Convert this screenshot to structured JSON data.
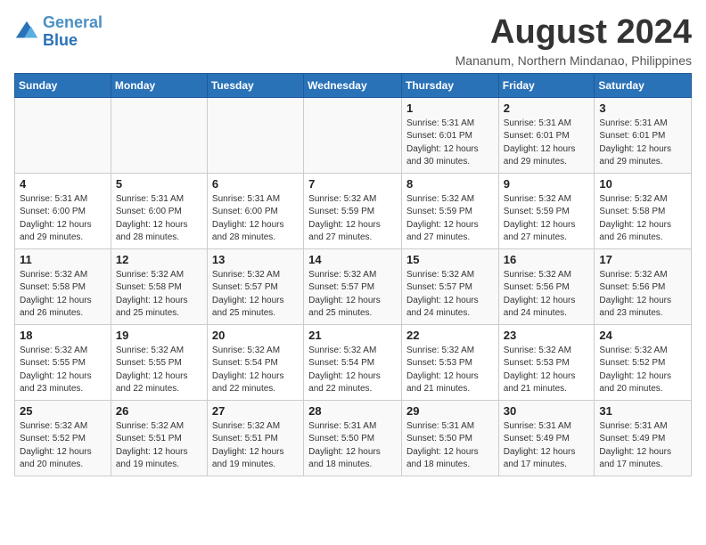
{
  "header": {
    "logo_line1": "General",
    "logo_line2": "Blue",
    "title": "August 2024",
    "subtitle": "Mananum, Northern Mindanao, Philippines"
  },
  "days_of_week": [
    "Sunday",
    "Monday",
    "Tuesday",
    "Wednesday",
    "Thursday",
    "Friday",
    "Saturday"
  ],
  "weeks": [
    [
      {
        "day": "",
        "info": ""
      },
      {
        "day": "",
        "info": ""
      },
      {
        "day": "",
        "info": ""
      },
      {
        "day": "",
        "info": ""
      },
      {
        "day": "1",
        "info": "Sunrise: 5:31 AM\nSunset: 6:01 PM\nDaylight: 12 hours\nand 30 minutes."
      },
      {
        "day": "2",
        "info": "Sunrise: 5:31 AM\nSunset: 6:01 PM\nDaylight: 12 hours\nand 29 minutes."
      },
      {
        "day": "3",
        "info": "Sunrise: 5:31 AM\nSunset: 6:01 PM\nDaylight: 12 hours\nand 29 minutes."
      }
    ],
    [
      {
        "day": "4",
        "info": "Sunrise: 5:31 AM\nSunset: 6:00 PM\nDaylight: 12 hours\nand 29 minutes."
      },
      {
        "day": "5",
        "info": "Sunrise: 5:31 AM\nSunset: 6:00 PM\nDaylight: 12 hours\nand 28 minutes."
      },
      {
        "day": "6",
        "info": "Sunrise: 5:31 AM\nSunset: 6:00 PM\nDaylight: 12 hours\nand 28 minutes."
      },
      {
        "day": "7",
        "info": "Sunrise: 5:32 AM\nSunset: 5:59 PM\nDaylight: 12 hours\nand 27 minutes."
      },
      {
        "day": "8",
        "info": "Sunrise: 5:32 AM\nSunset: 5:59 PM\nDaylight: 12 hours\nand 27 minutes."
      },
      {
        "day": "9",
        "info": "Sunrise: 5:32 AM\nSunset: 5:59 PM\nDaylight: 12 hours\nand 27 minutes."
      },
      {
        "day": "10",
        "info": "Sunrise: 5:32 AM\nSunset: 5:58 PM\nDaylight: 12 hours\nand 26 minutes."
      }
    ],
    [
      {
        "day": "11",
        "info": "Sunrise: 5:32 AM\nSunset: 5:58 PM\nDaylight: 12 hours\nand 26 minutes."
      },
      {
        "day": "12",
        "info": "Sunrise: 5:32 AM\nSunset: 5:58 PM\nDaylight: 12 hours\nand 25 minutes."
      },
      {
        "day": "13",
        "info": "Sunrise: 5:32 AM\nSunset: 5:57 PM\nDaylight: 12 hours\nand 25 minutes."
      },
      {
        "day": "14",
        "info": "Sunrise: 5:32 AM\nSunset: 5:57 PM\nDaylight: 12 hours\nand 25 minutes."
      },
      {
        "day": "15",
        "info": "Sunrise: 5:32 AM\nSunset: 5:57 PM\nDaylight: 12 hours\nand 24 minutes."
      },
      {
        "day": "16",
        "info": "Sunrise: 5:32 AM\nSunset: 5:56 PM\nDaylight: 12 hours\nand 24 minutes."
      },
      {
        "day": "17",
        "info": "Sunrise: 5:32 AM\nSunset: 5:56 PM\nDaylight: 12 hours\nand 23 minutes."
      }
    ],
    [
      {
        "day": "18",
        "info": "Sunrise: 5:32 AM\nSunset: 5:55 PM\nDaylight: 12 hours\nand 23 minutes."
      },
      {
        "day": "19",
        "info": "Sunrise: 5:32 AM\nSunset: 5:55 PM\nDaylight: 12 hours\nand 22 minutes."
      },
      {
        "day": "20",
        "info": "Sunrise: 5:32 AM\nSunset: 5:54 PM\nDaylight: 12 hours\nand 22 minutes."
      },
      {
        "day": "21",
        "info": "Sunrise: 5:32 AM\nSunset: 5:54 PM\nDaylight: 12 hours\nand 22 minutes."
      },
      {
        "day": "22",
        "info": "Sunrise: 5:32 AM\nSunset: 5:53 PM\nDaylight: 12 hours\nand 21 minutes."
      },
      {
        "day": "23",
        "info": "Sunrise: 5:32 AM\nSunset: 5:53 PM\nDaylight: 12 hours\nand 21 minutes."
      },
      {
        "day": "24",
        "info": "Sunrise: 5:32 AM\nSunset: 5:52 PM\nDaylight: 12 hours\nand 20 minutes."
      }
    ],
    [
      {
        "day": "25",
        "info": "Sunrise: 5:32 AM\nSunset: 5:52 PM\nDaylight: 12 hours\nand 20 minutes."
      },
      {
        "day": "26",
        "info": "Sunrise: 5:32 AM\nSunset: 5:51 PM\nDaylight: 12 hours\nand 19 minutes."
      },
      {
        "day": "27",
        "info": "Sunrise: 5:32 AM\nSunset: 5:51 PM\nDaylight: 12 hours\nand 19 minutes."
      },
      {
        "day": "28",
        "info": "Sunrise: 5:31 AM\nSunset: 5:50 PM\nDaylight: 12 hours\nand 18 minutes."
      },
      {
        "day": "29",
        "info": "Sunrise: 5:31 AM\nSunset: 5:50 PM\nDaylight: 12 hours\nand 18 minutes."
      },
      {
        "day": "30",
        "info": "Sunrise: 5:31 AM\nSunset: 5:49 PM\nDaylight: 12 hours\nand 17 minutes."
      },
      {
        "day": "31",
        "info": "Sunrise: 5:31 AM\nSunset: 5:49 PM\nDaylight: 12 hours\nand 17 minutes."
      }
    ]
  ]
}
